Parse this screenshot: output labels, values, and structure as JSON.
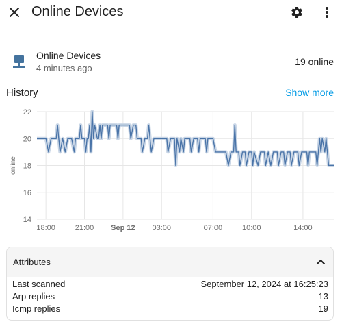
{
  "header": {
    "title": "Online Devices",
    "close_icon": "close-icon",
    "settings_icon": "gear-icon",
    "more_icon": "more-vertical-icon"
  },
  "entity": {
    "icon": "lan-icon",
    "name": "Online Devices",
    "last_changed": "4 minutes ago",
    "state": "19 online"
  },
  "history": {
    "title": "History",
    "show_more": "Show more"
  },
  "chart_data": {
    "type": "line",
    "title": "",
    "xlabel": "",
    "ylabel": "online",
    "ylim": [
      14,
      22
    ],
    "yticks": [
      "22",
      "20",
      "18",
      "16",
      "14"
    ],
    "xticks": [
      {
        "label": "18:00",
        "x": 18,
        "bold": false
      },
      {
        "label": "21:00",
        "x": 21,
        "bold": false
      },
      {
        "label": "Sep 12",
        "x": 24,
        "bold": true
      },
      {
        "label": "03:00",
        "x": 27,
        "bold": false
      },
      {
        "label": "07:00",
        "x": 31,
        "bold": false
      },
      {
        "label": "10:00",
        "x": 34,
        "bold": false
      },
      {
        "label": "14:00",
        "x": 38,
        "bold": false
      }
    ],
    "xlim": [
      17.3,
      40.4
    ],
    "grid": true,
    "color": "#4a74a8",
    "band_color": "#c9d6e6",
    "series": [
      {
        "values": [
          [
            17.3,
            20
          ],
          [
            18.0,
            20
          ],
          [
            18.2,
            19
          ],
          [
            18.4,
            20
          ],
          [
            18.8,
            20
          ],
          [
            18.9,
            21
          ],
          [
            19.0,
            20
          ],
          [
            19.1,
            19
          ],
          [
            19.3,
            20
          ],
          [
            19.5,
            19
          ],
          [
            19.7,
            20
          ],
          [
            20.0,
            20
          ],
          [
            20.2,
            19
          ],
          [
            20.3,
            20
          ],
          [
            20.6,
            20
          ],
          [
            20.7,
            21
          ],
          [
            20.8,
            20
          ],
          [
            21.0,
            20
          ],
          [
            21.1,
            19
          ],
          [
            21.2,
            20
          ],
          [
            21.3,
            20
          ],
          [
            21.4,
            21
          ],
          [
            21.5,
            19
          ],
          [
            21.6,
            22
          ],
          [
            21.7,
            20
          ],
          [
            21.8,
            21
          ],
          [
            22.0,
            20
          ],
          [
            22.1,
            20
          ],
          [
            22.2,
            21
          ],
          [
            22.3,
            20
          ],
          [
            22.4,
            21
          ],
          [
            22.8,
            21
          ],
          [
            22.9,
            20
          ],
          [
            23.0,
            21
          ],
          [
            23.5,
            21
          ],
          [
            23.6,
            20
          ],
          [
            23.7,
            21
          ],
          [
            24.5,
            21
          ],
          [
            24.6,
            20
          ],
          [
            24.8,
            21
          ],
          [
            25.0,
            21
          ],
          [
            25.1,
            20
          ],
          [
            25.4,
            20
          ],
          [
            25.5,
            19
          ],
          [
            25.7,
            20
          ],
          [
            25.9,
            20
          ],
          [
            26.0,
            21
          ],
          [
            26.1,
            20
          ],
          [
            26.2,
            19
          ],
          [
            26.4,
            20
          ],
          [
            27.4,
            20
          ],
          [
            27.5,
            19
          ],
          [
            27.7,
            20
          ],
          [
            28.0,
            20
          ],
          [
            28.1,
            18
          ],
          [
            28.2,
            20
          ],
          [
            28.4,
            19
          ],
          [
            28.5,
            20
          ],
          [
            28.7,
            19
          ],
          [
            28.8,
            20
          ],
          [
            29.2,
            20
          ],
          [
            29.3,
            19
          ],
          [
            29.5,
            20
          ],
          [
            29.8,
            20
          ],
          [
            29.9,
            19
          ],
          [
            30.0,
            20
          ],
          [
            30.4,
            20
          ],
          [
            30.5,
            19
          ],
          [
            30.6,
            20
          ],
          [
            31.0,
            20
          ],
          [
            31.2,
            19
          ],
          [
            32.0,
            19
          ],
          [
            32.2,
            18
          ],
          [
            32.4,
            19
          ],
          [
            32.6,
            19
          ],
          [
            32.7,
            21
          ],
          [
            32.8,
            19
          ],
          [
            33.0,
            19
          ],
          [
            33.1,
            18
          ],
          [
            33.3,
            19
          ],
          [
            33.5,
            19
          ],
          [
            33.6,
            18
          ],
          [
            33.8,
            19
          ],
          [
            34.0,
            19
          ],
          [
            34.1,
            18
          ],
          [
            34.2,
            19
          ],
          [
            34.5,
            18
          ],
          [
            34.7,
            19
          ],
          [
            35.0,
            19
          ],
          [
            35.1,
            18
          ],
          [
            35.3,
            19
          ],
          [
            35.5,
            18
          ],
          [
            35.7,
            19
          ],
          [
            36.0,
            19
          ],
          [
            36.1,
            18
          ],
          [
            36.3,
            19
          ],
          [
            36.5,
            19
          ],
          [
            36.6,
            18
          ],
          [
            36.8,
            19
          ],
          [
            37.0,
            19
          ],
          [
            37.1,
            18
          ],
          [
            37.3,
            19
          ],
          [
            37.6,
            19
          ],
          [
            37.7,
            18
          ],
          [
            37.9,
            19
          ],
          [
            38.3,
            19
          ],
          [
            38.4,
            18
          ],
          [
            38.5,
            19
          ],
          [
            39.0,
            19
          ],
          [
            39.1,
            18
          ],
          [
            39.2,
            19
          ],
          [
            39.3,
            20
          ],
          [
            39.4,
            19
          ],
          [
            39.5,
            20
          ],
          [
            39.7,
            19
          ],
          [
            39.8,
            20
          ],
          [
            39.9,
            19
          ],
          [
            40.0,
            18
          ],
          [
            40.4,
            18
          ]
        ]
      }
    ]
  },
  "attributes": {
    "title": "Attributes",
    "chevron_icon": "chevron-up-icon",
    "rows": [
      {
        "key": "Last scanned",
        "value": "September 12, 2024 at 16:25:23"
      },
      {
        "key": "Arp replies",
        "value": "13"
      },
      {
        "key": "Icmp replies",
        "value": "19"
      }
    ]
  }
}
